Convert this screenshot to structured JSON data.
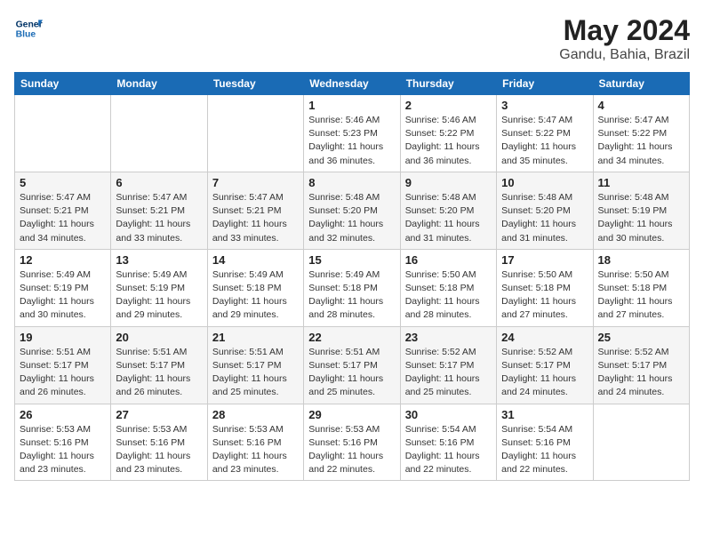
{
  "logo": {
    "line1": "General",
    "line2": "Blue"
  },
  "title": "May 2024",
  "location": "Gandu, Bahia, Brazil",
  "days_of_week": [
    "Sunday",
    "Monday",
    "Tuesday",
    "Wednesday",
    "Thursday",
    "Friday",
    "Saturday"
  ],
  "weeks": [
    [
      {
        "day": "",
        "sunrise": "",
        "sunset": "",
        "daylight": ""
      },
      {
        "day": "",
        "sunrise": "",
        "sunset": "",
        "daylight": ""
      },
      {
        "day": "",
        "sunrise": "",
        "sunset": "",
        "daylight": ""
      },
      {
        "day": "1",
        "sunrise": "Sunrise: 5:46 AM",
        "sunset": "Sunset: 5:23 PM",
        "daylight": "Daylight: 11 hours and 36 minutes."
      },
      {
        "day": "2",
        "sunrise": "Sunrise: 5:46 AM",
        "sunset": "Sunset: 5:22 PM",
        "daylight": "Daylight: 11 hours and 36 minutes."
      },
      {
        "day": "3",
        "sunrise": "Sunrise: 5:47 AM",
        "sunset": "Sunset: 5:22 PM",
        "daylight": "Daylight: 11 hours and 35 minutes."
      },
      {
        "day": "4",
        "sunrise": "Sunrise: 5:47 AM",
        "sunset": "Sunset: 5:22 PM",
        "daylight": "Daylight: 11 hours and 34 minutes."
      }
    ],
    [
      {
        "day": "5",
        "sunrise": "Sunrise: 5:47 AM",
        "sunset": "Sunset: 5:21 PM",
        "daylight": "Daylight: 11 hours and 34 minutes."
      },
      {
        "day": "6",
        "sunrise": "Sunrise: 5:47 AM",
        "sunset": "Sunset: 5:21 PM",
        "daylight": "Daylight: 11 hours and 33 minutes."
      },
      {
        "day": "7",
        "sunrise": "Sunrise: 5:47 AM",
        "sunset": "Sunset: 5:21 PM",
        "daylight": "Daylight: 11 hours and 33 minutes."
      },
      {
        "day": "8",
        "sunrise": "Sunrise: 5:48 AM",
        "sunset": "Sunset: 5:20 PM",
        "daylight": "Daylight: 11 hours and 32 minutes."
      },
      {
        "day": "9",
        "sunrise": "Sunrise: 5:48 AM",
        "sunset": "Sunset: 5:20 PM",
        "daylight": "Daylight: 11 hours and 31 minutes."
      },
      {
        "day": "10",
        "sunrise": "Sunrise: 5:48 AM",
        "sunset": "Sunset: 5:20 PM",
        "daylight": "Daylight: 11 hours and 31 minutes."
      },
      {
        "day": "11",
        "sunrise": "Sunrise: 5:48 AM",
        "sunset": "Sunset: 5:19 PM",
        "daylight": "Daylight: 11 hours and 30 minutes."
      }
    ],
    [
      {
        "day": "12",
        "sunrise": "Sunrise: 5:49 AM",
        "sunset": "Sunset: 5:19 PM",
        "daylight": "Daylight: 11 hours and 30 minutes."
      },
      {
        "day": "13",
        "sunrise": "Sunrise: 5:49 AM",
        "sunset": "Sunset: 5:19 PM",
        "daylight": "Daylight: 11 hours and 29 minutes."
      },
      {
        "day": "14",
        "sunrise": "Sunrise: 5:49 AM",
        "sunset": "Sunset: 5:18 PM",
        "daylight": "Daylight: 11 hours and 29 minutes."
      },
      {
        "day": "15",
        "sunrise": "Sunrise: 5:49 AM",
        "sunset": "Sunset: 5:18 PM",
        "daylight": "Daylight: 11 hours and 28 minutes."
      },
      {
        "day": "16",
        "sunrise": "Sunrise: 5:50 AM",
        "sunset": "Sunset: 5:18 PM",
        "daylight": "Daylight: 11 hours and 28 minutes."
      },
      {
        "day": "17",
        "sunrise": "Sunrise: 5:50 AM",
        "sunset": "Sunset: 5:18 PM",
        "daylight": "Daylight: 11 hours and 27 minutes."
      },
      {
        "day": "18",
        "sunrise": "Sunrise: 5:50 AM",
        "sunset": "Sunset: 5:18 PM",
        "daylight": "Daylight: 11 hours and 27 minutes."
      }
    ],
    [
      {
        "day": "19",
        "sunrise": "Sunrise: 5:51 AM",
        "sunset": "Sunset: 5:17 PM",
        "daylight": "Daylight: 11 hours and 26 minutes."
      },
      {
        "day": "20",
        "sunrise": "Sunrise: 5:51 AM",
        "sunset": "Sunset: 5:17 PM",
        "daylight": "Daylight: 11 hours and 26 minutes."
      },
      {
        "day": "21",
        "sunrise": "Sunrise: 5:51 AM",
        "sunset": "Sunset: 5:17 PM",
        "daylight": "Daylight: 11 hours and 25 minutes."
      },
      {
        "day": "22",
        "sunrise": "Sunrise: 5:51 AM",
        "sunset": "Sunset: 5:17 PM",
        "daylight": "Daylight: 11 hours and 25 minutes."
      },
      {
        "day": "23",
        "sunrise": "Sunrise: 5:52 AM",
        "sunset": "Sunset: 5:17 PM",
        "daylight": "Daylight: 11 hours and 25 minutes."
      },
      {
        "day": "24",
        "sunrise": "Sunrise: 5:52 AM",
        "sunset": "Sunset: 5:17 PM",
        "daylight": "Daylight: 11 hours and 24 minutes."
      },
      {
        "day": "25",
        "sunrise": "Sunrise: 5:52 AM",
        "sunset": "Sunset: 5:17 PM",
        "daylight": "Daylight: 11 hours and 24 minutes."
      }
    ],
    [
      {
        "day": "26",
        "sunrise": "Sunrise: 5:53 AM",
        "sunset": "Sunset: 5:16 PM",
        "daylight": "Daylight: 11 hours and 23 minutes."
      },
      {
        "day": "27",
        "sunrise": "Sunrise: 5:53 AM",
        "sunset": "Sunset: 5:16 PM",
        "daylight": "Daylight: 11 hours and 23 minutes."
      },
      {
        "day": "28",
        "sunrise": "Sunrise: 5:53 AM",
        "sunset": "Sunset: 5:16 PM",
        "daylight": "Daylight: 11 hours and 23 minutes."
      },
      {
        "day": "29",
        "sunrise": "Sunrise: 5:53 AM",
        "sunset": "Sunset: 5:16 PM",
        "daylight": "Daylight: 11 hours and 22 minutes."
      },
      {
        "day": "30",
        "sunrise": "Sunrise: 5:54 AM",
        "sunset": "Sunset: 5:16 PM",
        "daylight": "Daylight: 11 hours and 22 minutes."
      },
      {
        "day": "31",
        "sunrise": "Sunrise: 5:54 AM",
        "sunset": "Sunset: 5:16 PM",
        "daylight": "Daylight: 11 hours and 22 minutes."
      },
      {
        "day": "",
        "sunrise": "",
        "sunset": "",
        "daylight": ""
      }
    ]
  ]
}
